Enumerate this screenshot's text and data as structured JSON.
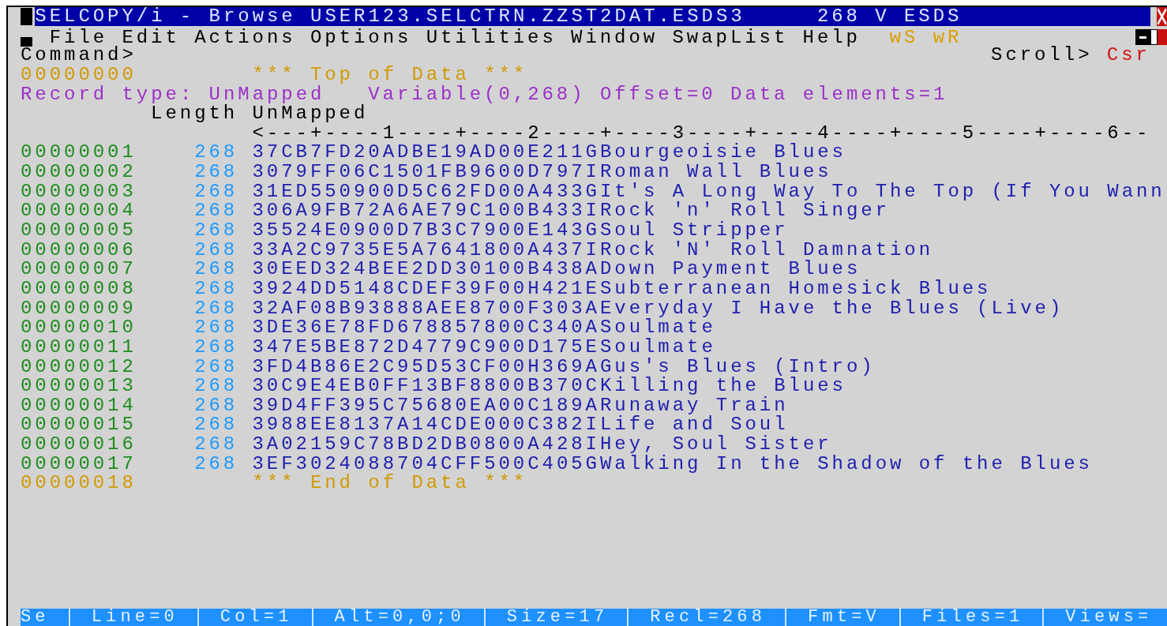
{
  "window": {
    "title": "SELCOPY/i - Browse USER123.SELCTRN.ZZST2DAT.ESDS3",
    "info": "268 V ESDS"
  },
  "menu": [
    {
      "label": "File"
    },
    {
      "label": "Edit"
    },
    {
      "label": "Actions"
    },
    {
      "label": "Options"
    },
    {
      "label": "Utilities"
    },
    {
      "label": "Window"
    },
    {
      "label": "SwapList"
    },
    {
      "label": "Help"
    }
  ],
  "window_list": [
    {
      "label": "wS"
    },
    {
      "label": "wR"
    }
  ],
  "command": {
    "label": "Command>"
  },
  "scroll": {
    "label": "Scroll>",
    "value": "Csr"
  },
  "top_marker": {
    "line": "00000000",
    "text": "*** Top of Data ***"
  },
  "record_info": {
    "type": "Record type: UnMapped",
    "details": "Variable(0,268) Offset=0 Data elements=1"
  },
  "headers": {
    "length": "Length",
    "data": "UnMapped"
  },
  "ruler": "<---+----1----+----2----+----3----+----4----+----5----+----6--",
  "records": [
    {
      "line": "00000001",
      "length": "268",
      "data": "37CB7FD20ADBE19AD00E211GBourgeoisie Blues"
    },
    {
      "line": "00000002",
      "length": "268",
      "data": "3079FF06C1501FB9600D797IRoman Wall Blues"
    },
    {
      "line": "00000003",
      "length": "268",
      "data": "31ED550900D5C62FD00A433GIt's A Long Way To The Top (If You Wann"
    },
    {
      "line": "00000004",
      "length": "268",
      "data": "306A9FB72A6AE79C100B433IRock 'n' Roll Singer"
    },
    {
      "line": "00000005",
      "length": "268",
      "data": "35524E0900D7B3C7900E143GSoul Stripper"
    },
    {
      "line": "00000006",
      "length": "268",
      "data": "33A2C9735E5A7641800A437IRock 'N' Roll Damnation"
    },
    {
      "line": "00000007",
      "length": "268",
      "data": "30EED324BEE2DD30100B438ADown Payment Blues"
    },
    {
      "line": "00000008",
      "length": "268",
      "data": "3924DD5148CDEF39F00H421ESubterranean Homesick Blues"
    },
    {
      "line": "00000009",
      "length": "268",
      "data": "32AF08B93888AEE8700F303AEveryday I Have the Blues (Live)"
    },
    {
      "line": "00000010",
      "length": "268",
      "data": "3DE36E78FD678857800C340ASoulmate"
    },
    {
      "line": "00000011",
      "length": "268",
      "data": "347E5BE872D4779C900D175ESoulmate"
    },
    {
      "line": "00000012",
      "length": "268",
      "data": "3FD4B86E2C95D53CF00H369AGus's Blues (Intro)"
    },
    {
      "line": "00000013",
      "length": "268",
      "data": "30C9E4EB0FF13BF8800B370CKilling the Blues"
    },
    {
      "line": "00000014",
      "length": "268",
      "data": "39D4FF395C75680EA00C189ARunaway Train"
    },
    {
      "line": "00000015",
      "length": "268",
      "data": "3988EE8137A14CDE000C382ILife and Soul"
    },
    {
      "line": "00000016",
      "length": "268",
      "data": "3A02159C78BD2DB0800A428IHey, Soul Sister"
    },
    {
      "line": "00000017",
      "length": "268",
      "data": "3EF3024088704CFF500C405GWalking In the Shadow of the Blues"
    }
  ],
  "end_marker": {
    "line": "00000018",
    "text": "*** End of Data ***"
  },
  "status_bar": [
    "Se",
    "Line=0",
    "Col=1",
    "Alt=0,0;0",
    "Size=17",
    "Recl=268",
    "Fmt=V",
    "Files=1",
    "Views="
  ]
}
